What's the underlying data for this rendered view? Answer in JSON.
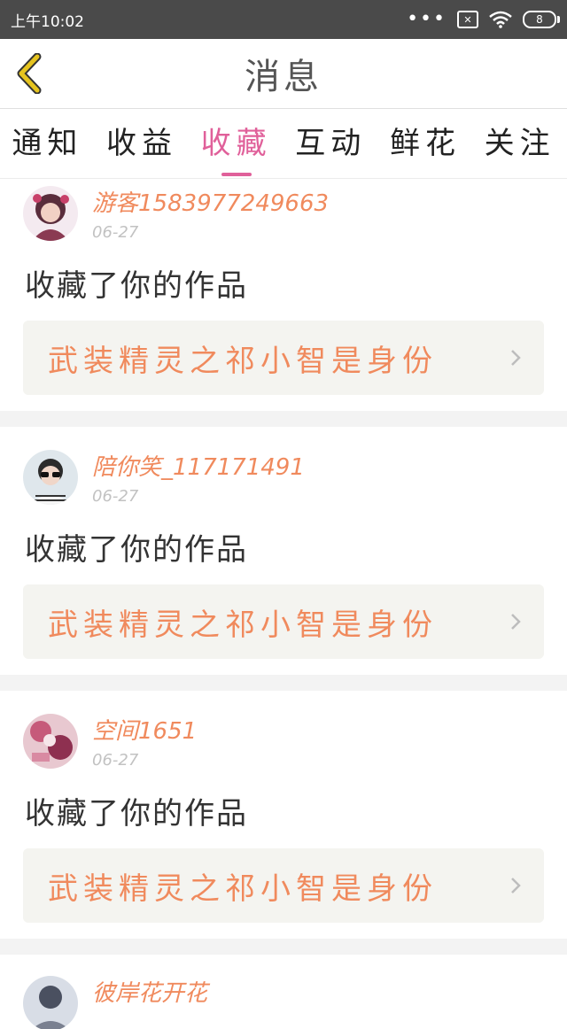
{
  "status_bar": {
    "time": "上午10:02",
    "sim": "✕",
    "battery": "8"
  },
  "header": {
    "title": "消息"
  },
  "tabs": [
    {
      "label": "通知"
    },
    {
      "label": "收益"
    },
    {
      "label": "收藏"
    },
    {
      "label": "互动"
    },
    {
      "label": "鲜花"
    },
    {
      "label": "关注"
    }
  ],
  "active_tab": "收藏",
  "messages": [
    {
      "username": "游客1583977249663",
      "date": "06-27",
      "action": "收藏了你的作品",
      "work": "武装精灵之祁小智是身份"
    },
    {
      "username": "陪你笑_117171491",
      "date": "06-27",
      "action": "收藏了你的作品",
      "work": "武装精灵之祁小智是身份"
    },
    {
      "username": "空间1651",
      "date": "06-27",
      "action": "收藏了你的作品",
      "work": "武装精灵之祁小智是身份"
    },
    {
      "username": "彼岸花开花"
    }
  ],
  "colors": {
    "accent": "#e0609a",
    "username": "#f08a5d",
    "back_arrow": "#e6c41f"
  }
}
